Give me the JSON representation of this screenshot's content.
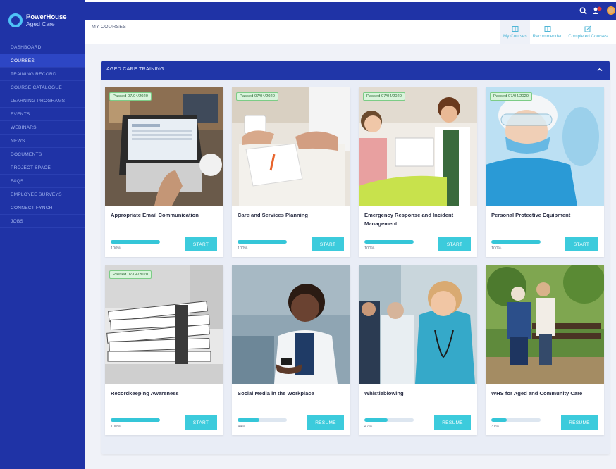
{
  "brand": {
    "line1": "PowerHouse",
    "line2": "Aged Care"
  },
  "sidebar": {
    "items": [
      {
        "label": "DASHBOARD"
      },
      {
        "label": "COURSES"
      },
      {
        "label": "TRAINING RECORD"
      },
      {
        "label": "COURSE CATALOGUE"
      },
      {
        "label": "LEARNING PROGRAMS"
      },
      {
        "label": "EVENTS"
      },
      {
        "label": "WEBINARS"
      },
      {
        "label": "NEWS"
      },
      {
        "label": "DOCUMENTS"
      },
      {
        "label": "PROJECT SPACE"
      },
      {
        "label": "FAQS"
      },
      {
        "label": "EMPLOYEE SURVEYS"
      },
      {
        "label": "CONNECT FYNCH"
      },
      {
        "label": "JOBS"
      }
    ],
    "active_index": 1
  },
  "topbar": {
    "icons": [
      "search-icon",
      "notification-icon",
      "user-avatar"
    ]
  },
  "header": {
    "title": "MY COURSES",
    "tabs": [
      {
        "label": "My Courses",
        "icon": "book-icon"
      },
      {
        "label": "Recommended",
        "icon": "book-icon"
      },
      {
        "label": "Completed Courses",
        "icon": "edit-icon"
      }
    ],
    "active_tab": 0
  },
  "section": {
    "title": "AGED CARE TRAINING"
  },
  "colors": {
    "sidebar": "#1f33a6",
    "header": "#2036a8",
    "accent": "#3ccbdc",
    "badge_bg": "#d9f4dc"
  },
  "courses": [
    {
      "title": "Appropriate Email Communication",
      "badge": "Passed 07/04/2020",
      "progress": 100,
      "progress_label": "100%",
      "action": "START"
    },
    {
      "title": "Care and Services Planning",
      "badge": "Passed 07/04/2020",
      "progress": 100,
      "progress_label": "100%",
      "action": "START"
    },
    {
      "title": "Emergency Response and Incident Management",
      "badge": "Passed 07/04/2020",
      "progress": 100,
      "progress_label": "100%",
      "action": "START"
    },
    {
      "title": "Personal Protective Equipment",
      "badge": "Passed 07/04/2020",
      "progress": 100,
      "progress_label": "100%",
      "action": "START"
    },
    {
      "title": "Recordkeeping Awareness",
      "badge": "Passed 07/04/2020",
      "progress": 100,
      "progress_label": "100%",
      "action": "START"
    },
    {
      "title": "Social Media in the Workplace",
      "badge": "",
      "progress": 44,
      "progress_label": "44%",
      "action": "RESUME"
    },
    {
      "title": "Whistleblowing",
      "badge": "",
      "progress": 47,
      "progress_label": "47%",
      "action": "RESUME"
    },
    {
      "title": "WHS for Aged and Community Care",
      "badge": "",
      "progress": 31,
      "progress_label": "31%",
      "action": "RESUME"
    }
  ]
}
